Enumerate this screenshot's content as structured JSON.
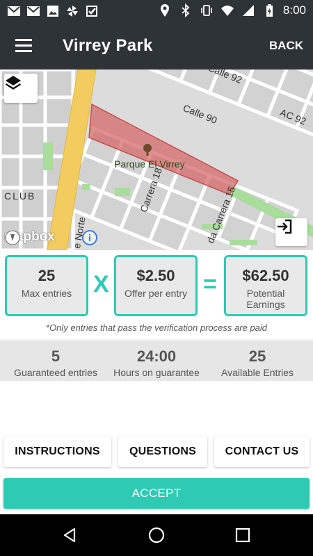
{
  "status_bar": {
    "time": "8:00",
    "left_icons": [
      "gmail-icon",
      "gmail-icon",
      "image-icon",
      "pinwheel-icon",
      "check-app-icon"
    ],
    "right_icons": [
      "location-icon",
      "bluetooth-icon",
      "vibrate-icon",
      "wifi-icon",
      "signal-icon",
      "battery-charging-icon"
    ]
  },
  "app_bar": {
    "title": "Virrey Park",
    "back_label": "BACK",
    "menu_icon": "hamburger-menu-icon"
  },
  "map": {
    "labels": {
      "calle_92": "Calle 92",
      "calle_90": "Calle 90",
      "ac_92": "AC 92",
      "park": "Parque El Virrey",
      "club": "CLUB",
      "carrera_18": "Carrera 18",
      "carrera_15": "da Carrera 15",
      "norte": "e Norte"
    },
    "attribution": "mapbox",
    "layers_icon": "layers-icon",
    "exit_icon": "exit-icon",
    "info_icon": "info-icon",
    "colors": {
      "highway": "#f2cc5e",
      "park_fill": "#d66a6a",
      "green": "#a8dd9c"
    }
  },
  "calc": {
    "max_entries": {
      "value": "25",
      "label": "Max entries"
    },
    "multiply": "X",
    "offer": {
      "value": "$2.50",
      "label": "Offer per entry"
    },
    "equals": "=",
    "earnings": {
      "value": "$62.50",
      "label": "Potential Earnings"
    }
  },
  "note": "*Only entries that pass the verification process are paid",
  "stats": [
    {
      "value": "5",
      "label": "Guaranteed entries"
    },
    {
      "value": "24:00",
      "label": "Hours on guarantee"
    },
    {
      "value": "25",
      "label": "Available Entries"
    }
  ],
  "buttons": {
    "instructions": "INSTRUCTIONS",
    "questions": "QUESTIONS",
    "contact": "CONTACT US",
    "accept": "ACCEPT"
  },
  "nav_bar": {
    "back_icon": "nav-back-icon",
    "home_icon": "nav-home-icon",
    "recents_icon": "nav-recents-icon"
  },
  "colors": {
    "accent": "#2ecab4",
    "app_bar": "#2d3337"
  }
}
